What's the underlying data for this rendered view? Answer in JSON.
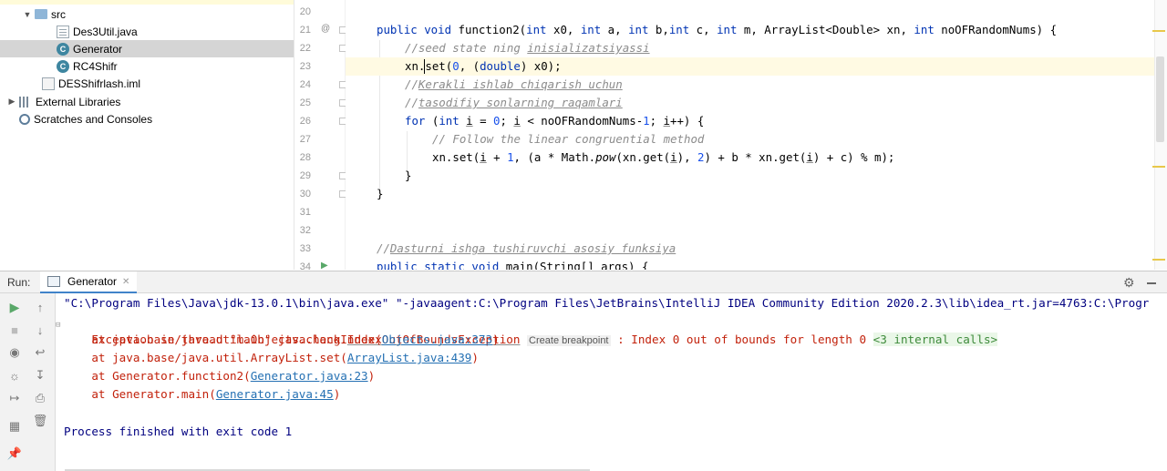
{
  "project_tree": {
    "items": [
      {
        "label": "src",
        "icon": "folder-icon",
        "expanded": true
      },
      {
        "label": "Des3Util.java",
        "icon": "java-file-icon"
      },
      {
        "label": "Generator",
        "icon": "class-icon",
        "selected": true
      },
      {
        "label": "RC4Shifr",
        "icon": "class-icon"
      },
      {
        "label": "DESShifrlash.iml",
        "icon": "iml-file-icon"
      },
      {
        "label": "External Libraries",
        "icon": "libraries-icon"
      },
      {
        "label": "Scratches and Consoles",
        "icon": "scratches-icon"
      }
    ]
  },
  "editor": {
    "line_numbers": [
      "20",
      "21",
      "22",
      "23",
      "24",
      "25",
      "26",
      "27",
      "28",
      "29",
      "30",
      "31",
      "32",
      "33",
      "34"
    ],
    "gutter_annotation": "@",
    "current_line": "23"
  },
  "run_panel": {
    "label": "Run:",
    "tab_label": "Generator",
    "console": {
      "cmd": "\"C:\\Program Files\\Java\\jdk-13.0.1\\bin\\java.exe\" \"-javaagent:C:\\Program Files\\JetBrains\\IntelliJ IDEA Community Edition 2020.2.3\\lib\\idea_rt.jar=4763:C:\\Progr",
      "exception_prefix": "Exception in thread \"main\" java.lang.",
      "exception_class": "IndexOutOfBoundsException",
      "breakpoint_hint": "Create breakpoint",
      "exception_msg": " : Index 0 out of bounds for length 0 ",
      "internal_calls": "<3 internal calls>",
      "stack": [
        {
          "prefix": "    at java.base/java.util.Objects.checkIndex(",
          "link": "Objects.java:373",
          "suffix": ")"
        },
        {
          "prefix": "    at java.base/java.util.ArrayList.set(",
          "link": "ArrayList.java:439",
          "suffix": ")"
        },
        {
          "prefix": "    at Generator.function2(",
          "link": "Generator.java:23",
          "suffix": ")"
        },
        {
          "prefix": "    at Generator.main(",
          "link": "Generator.java:45",
          "suffix": ")"
        }
      ],
      "finished": "Process finished with exit code 1"
    }
  },
  "colors": {
    "keyword": "#0033b3",
    "comment": "#8c8c8c",
    "number": "#1750eb",
    "error": "#c2210b",
    "link": "#2470b3",
    "console_text": "#000080",
    "current_line_bg": "#fffae3"
  }
}
